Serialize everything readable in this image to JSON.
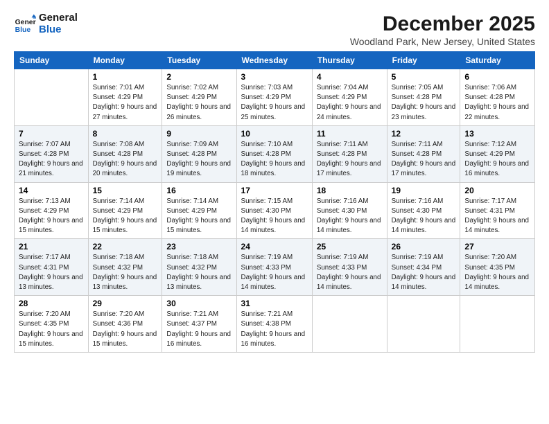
{
  "header": {
    "logo_line1": "General",
    "logo_line2": "Blue",
    "month": "December 2025",
    "location": "Woodland Park, New Jersey, United States"
  },
  "days": [
    "Sunday",
    "Monday",
    "Tuesday",
    "Wednesday",
    "Thursday",
    "Friday",
    "Saturday"
  ],
  "weeks": [
    [
      {
        "date": "",
        "sunrise": "",
        "sunset": "",
        "daylight": ""
      },
      {
        "date": "1",
        "sunrise": "Sunrise: 7:01 AM",
        "sunset": "Sunset: 4:29 PM",
        "daylight": "Daylight: 9 hours and 27 minutes."
      },
      {
        "date": "2",
        "sunrise": "Sunrise: 7:02 AM",
        "sunset": "Sunset: 4:29 PM",
        "daylight": "Daylight: 9 hours and 26 minutes."
      },
      {
        "date": "3",
        "sunrise": "Sunrise: 7:03 AM",
        "sunset": "Sunset: 4:29 PM",
        "daylight": "Daylight: 9 hours and 25 minutes."
      },
      {
        "date": "4",
        "sunrise": "Sunrise: 7:04 AM",
        "sunset": "Sunset: 4:29 PM",
        "daylight": "Daylight: 9 hours and 24 minutes."
      },
      {
        "date": "5",
        "sunrise": "Sunrise: 7:05 AM",
        "sunset": "Sunset: 4:28 PM",
        "daylight": "Daylight: 9 hours and 23 minutes."
      },
      {
        "date": "6",
        "sunrise": "Sunrise: 7:06 AM",
        "sunset": "Sunset: 4:28 PM",
        "daylight": "Daylight: 9 hours and 22 minutes."
      }
    ],
    [
      {
        "date": "7",
        "sunrise": "Sunrise: 7:07 AM",
        "sunset": "Sunset: 4:28 PM",
        "daylight": "Daylight: 9 hours and 21 minutes."
      },
      {
        "date": "8",
        "sunrise": "Sunrise: 7:08 AM",
        "sunset": "Sunset: 4:28 PM",
        "daylight": "Daylight: 9 hours and 20 minutes."
      },
      {
        "date": "9",
        "sunrise": "Sunrise: 7:09 AM",
        "sunset": "Sunset: 4:28 PM",
        "daylight": "Daylight: 9 hours and 19 minutes."
      },
      {
        "date": "10",
        "sunrise": "Sunrise: 7:10 AM",
        "sunset": "Sunset: 4:28 PM",
        "daylight": "Daylight: 9 hours and 18 minutes."
      },
      {
        "date": "11",
        "sunrise": "Sunrise: 7:11 AM",
        "sunset": "Sunset: 4:28 PM",
        "daylight": "Daylight: 9 hours and 17 minutes."
      },
      {
        "date": "12",
        "sunrise": "Sunrise: 7:11 AM",
        "sunset": "Sunset: 4:28 PM",
        "daylight": "Daylight: 9 hours and 17 minutes."
      },
      {
        "date": "13",
        "sunrise": "Sunrise: 7:12 AM",
        "sunset": "Sunset: 4:29 PM",
        "daylight": "Daylight: 9 hours and 16 minutes."
      }
    ],
    [
      {
        "date": "14",
        "sunrise": "Sunrise: 7:13 AM",
        "sunset": "Sunset: 4:29 PM",
        "daylight": "Daylight: 9 hours and 15 minutes."
      },
      {
        "date": "15",
        "sunrise": "Sunrise: 7:14 AM",
        "sunset": "Sunset: 4:29 PM",
        "daylight": "Daylight: 9 hours and 15 minutes."
      },
      {
        "date": "16",
        "sunrise": "Sunrise: 7:14 AM",
        "sunset": "Sunset: 4:29 PM",
        "daylight": "Daylight: 9 hours and 15 minutes."
      },
      {
        "date": "17",
        "sunrise": "Sunrise: 7:15 AM",
        "sunset": "Sunset: 4:30 PM",
        "daylight": "Daylight: 9 hours and 14 minutes."
      },
      {
        "date": "18",
        "sunrise": "Sunrise: 7:16 AM",
        "sunset": "Sunset: 4:30 PM",
        "daylight": "Daylight: 9 hours and 14 minutes."
      },
      {
        "date": "19",
        "sunrise": "Sunrise: 7:16 AM",
        "sunset": "Sunset: 4:30 PM",
        "daylight": "Daylight: 9 hours and 14 minutes."
      },
      {
        "date": "20",
        "sunrise": "Sunrise: 7:17 AM",
        "sunset": "Sunset: 4:31 PM",
        "daylight": "Daylight: 9 hours and 14 minutes."
      }
    ],
    [
      {
        "date": "21",
        "sunrise": "Sunrise: 7:17 AM",
        "sunset": "Sunset: 4:31 PM",
        "daylight": "Daylight: 9 hours and 13 minutes."
      },
      {
        "date": "22",
        "sunrise": "Sunrise: 7:18 AM",
        "sunset": "Sunset: 4:32 PM",
        "daylight": "Daylight: 9 hours and 13 minutes."
      },
      {
        "date": "23",
        "sunrise": "Sunrise: 7:18 AM",
        "sunset": "Sunset: 4:32 PM",
        "daylight": "Daylight: 9 hours and 13 minutes."
      },
      {
        "date": "24",
        "sunrise": "Sunrise: 7:19 AM",
        "sunset": "Sunset: 4:33 PM",
        "daylight": "Daylight: 9 hours and 14 minutes."
      },
      {
        "date": "25",
        "sunrise": "Sunrise: 7:19 AM",
        "sunset": "Sunset: 4:33 PM",
        "daylight": "Daylight: 9 hours and 14 minutes."
      },
      {
        "date": "26",
        "sunrise": "Sunrise: 7:19 AM",
        "sunset": "Sunset: 4:34 PM",
        "daylight": "Daylight: 9 hours and 14 minutes."
      },
      {
        "date": "27",
        "sunrise": "Sunrise: 7:20 AM",
        "sunset": "Sunset: 4:35 PM",
        "daylight": "Daylight: 9 hours and 14 minutes."
      }
    ],
    [
      {
        "date": "28",
        "sunrise": "Sunrise: 7:20 AM",
        "sunset": "Sunset: 4:35 PM",
        "daylight": "Daylight: 9 hours and 15 minutes."
      },
      {
        "date": "29",
        "sunrise": "Sunrise: 7:20 AM",
        "sunset": "Sunset: 4:36 PM",
        "daylight": "Daylight: 9 hours and 15 minutes."
      },
      {
        "date": "30",
        "sunrise": "Sunrise: 7:21 AM",
        "sunset": "Sunset: 4:37 PM",
        "daylight": "Daylight: 9 hours and 16 minutes."
      },
      {
        "date": "31",
        "sunrise": "Sunrise: 7:21 AM",
        "sunset": "Sunset: 4:38 PM",
        "daylight": "Daylight: 9 hours and 16 minutes."
      },
      {
        "date": "",
        "sunrise": "",
        "sunset": "",
        "daylight": ""
      },
      {
        "date": "",
        "sunrise": "",
        "sunset": "",
        "daylight": ""
      },
      {
        "date": "",
        "sunrise": "",
        "sunset": "",
        "daylight": ""
      }
    ]
  ]
}
